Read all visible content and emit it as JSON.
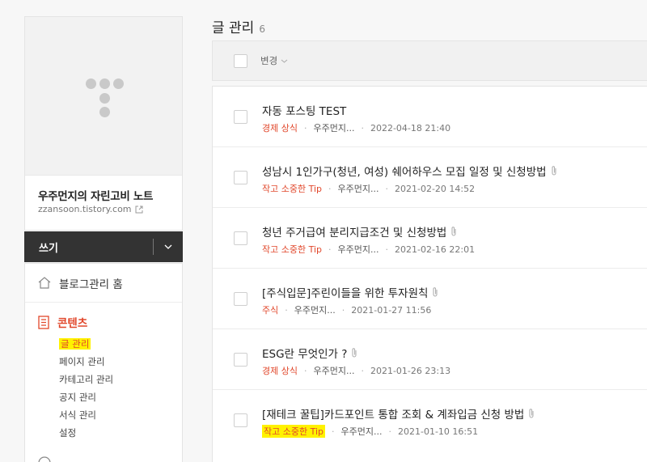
{
  "sidebar": {
    "blog_title": "우주먼지의 자린고비 노트",
    "blog_url": "zzansoon.tistory.com",
    "write_label": "쓰기",
    "menu": {
      "home": "블로그관리 홈",
      "contents": "콘텐츠",
      "sub_items": [
        "글 관리",
        "페이지 관리",
        "카테고리 관리",
        "공지 관리",
        "서식 관리",
        "설정"
      ]
    }
  },
  "main": {
    "title": "글 관리",
    "count": "6",
    "change_label": "변경",
    "posts": [
      {
        "title": "자동 포스팅 TEST",
        "category": "경제 상식",
        "author": "우주먼지...",
        "date": "2022-04-18 21:40",
        "attachment": false
      },
      {
        "title": "성남시 1인가구(청년, 여성) 쉐어하우스 모집 일정 및 신청방법",
        "category": "작고 소중한 Tip",
        "author": "우주먼지...",
        "date": "2021-02-20 14:52",
        "attachment": true
      },
      {
        "title": "청년 주거급여 분리지급조건 및 신청방법",
        "category": "작고 소중한 Tip",
        "author": "우주먼지...",
        "date": "2021-02-16 22:01",
        "attachment": true
      },
      {
        "title": "[주식입문]주린이들을 위한 투자원칙",
        "category": "주식",
        "author": "우주먼지...",
        "date": "2021-01-27 11:56",
        "attachment": true
      },
      {
        "title": "ESG란 무엇인가 ?",
        "category": "경제 상식",
        "author": "우주먼지...",
        "date": "2021-01-26 23:13",
        "attachment": true
      },
      {
        "title": "[재테크 꿀팁]카드포인트 통합 조회 & 계좌입금 신청 방법",
        "category": "작고 소중한 Tip",
        "author": "우주먼지...",
        "date": "2021-01-10 16:51",
        "attachment": true
      }
    ]
  },
  "colors": {
    "accent": "#e1472b",
    "highlight": "#fff200",
    "write_bar": "#333333"
  }
}
